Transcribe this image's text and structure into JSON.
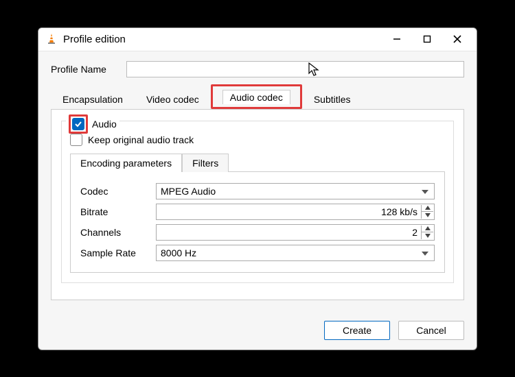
{
  "window": {
    "title": "Profile edition"
  },
  "profile": {
    "label": "Profile Name",
    "value": ""
  },
  "tabs": {
    "encapsulation": "Encapsulation",
    "video_codec": "Video codec",
    "audio_codec": "Audio codec",
    "subtitles": "Subtitles"
  },
  "audio": {
    "legend": "Audio",
    "checked": true,
    "keep_original": {
      "label": "Keep original audio track",
      "checked": false
    },
    "subtabs": {
      "encoding": "Encoding parameters",
      "filters": "Filters"
    },
    "codec": {
      "label": "Codec",
      "value": "MPEG Audio"
    },
    "bitrate": {
      "label": "Bitrate",
      "value": "128 kb/s"
    },
    "channels": {
      "label": "Channels",
      "value": "2"
    },
    "sample_rate": {
      "label": "Sample Rate",
      "value": "8000 Hz"
    }
  },
  "buttons": {
    "create": "Create",
    "cancel": "Cancel"
  }
}
